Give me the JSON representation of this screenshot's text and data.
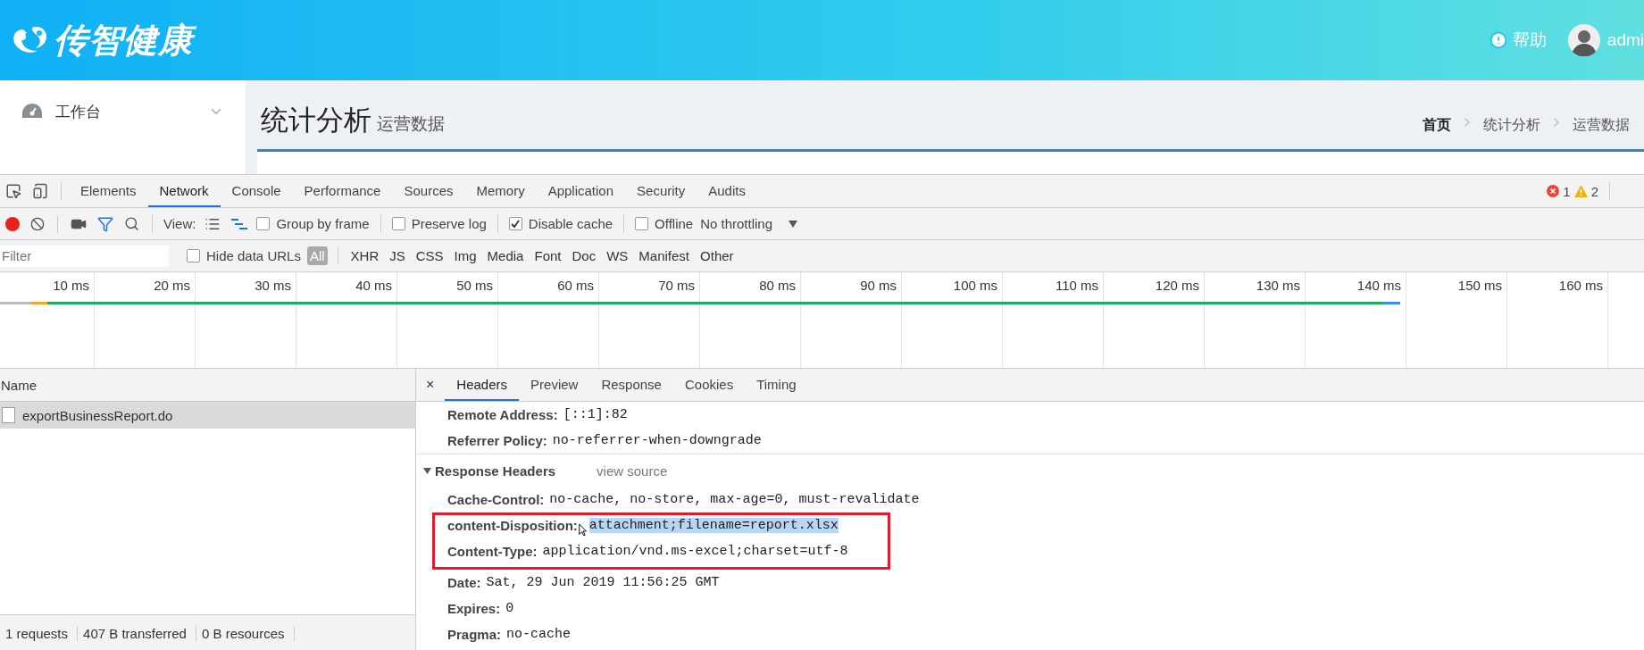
{
  "header": {
    "logo_text": "传智健康",
    "help": "帮助",
    "user": "admi"
  },
  "sidebar": {
    "items": [
      {
        "label": "工作台"
      }
    ]
  },
  "page": {
    "title": "统计分析",
    "subtitle": "运营数据",
    "breadcrumb": [
      "首页",
      "统计分析",
      "运营数据"
    ]
  },
  "devtools": {
    "tabs": [
      {
        "label": "Elements",
        "selected": false
      },
      {
        "label": "Network",
        "selected": true
      },
      {
        "label": "Console",
        "selected": false
      },
      {
        "label": "Performance",
        "selected": false
      },
      {
        "label": "Sources",
        "selected": false
      },
      {
        "label": "Memory",
        "selected": false
      },
      {
        "label": "Application",
        "selected": false
      },
      {
        "label": "Security",
        "selected": false
      },
      {
        "label": "Audits",
        "selected": false
      }
    ],
    "errors": "1",
    "warnings": "2",
    "toolbar": {
      "recording": true,
      "view_label": "View:",
      "options": [
        {
          "label": "Group by frame",
          "checked": false
        },
        {
          "label": "Preserve log",
          "checked": false
        },
        {
          "label": "Disable cache",
          "checked": true
        },
        {
          "label": "Offline",
          "checked": false
        }
      ],
      "throttling": "No throttling"
    },
    "filter": {
      "placeholder": "Filter",
      "hide_data_urls": {
        "label": "Hide data URLs",
        "checked": false
      },
      "types": [
        {
          "label": "All",
          "selected": true
        },
        {
          "label": "XHR",
          "selected": false
        },
        {
          "label": "JS",
          "selected": false
        },
        {
          "label": "CSS",
          "selected": false
        },
        {
          "label": "Img",
          "selected": false
        },
        {
          "label": "Media",
          "selected": false
        },
        {
          "label": "Font",
          "selected": false
        },
        {
          "label": "Doc",
          "selected": false
        },
        {
          "label": "WS",
          "selected": false
        },
        {
          "label": "Manifest",
          "selected": false
        },
        {
          "label": "Other",
          "selected": false
        }
      ]
    },
    "timeline": {
      "ticks": [
        "10 ms",
        "20 ms",
        "30 ms",
        "40 ms",
        "50 ms",
        "60 ms",
        "70 ms",
        "80 ms",
        "90 ms",
        "100 ms",
        "110 ms",
        "120 ms",
        "130 ms",
        "140 ms",
        "150 ms",
        "160 ms"
      ]
    },
    "requests": {
      "column": "Name",
      "rows": [
        {
          "name": "exportBusinessReport.do",
          "selected": true
        }
      ]
    },
    "details": {
      "close": "×",
      "tabs": [
        {
          "label": "Headers",
          "selected": true
        },
        {
          "label": "Preview",
          "selected": false
        },
        {
          "label": "Response",
          "selected": false
        },
        {
          "label": "Cookies",
          "selected": false
        },
        {
          "label": "Timing",
          "selected": false
        }
      ],
      "general": [
        {
          "key": "Remote Address:",
          "value": "[::1]:82"
        },
        {
          "key": "Referrer Policy:",
          "value": "no-referrer-when-downgrade"
        }
      ],
      "response_headers": {
        "title": "Response Headers",
        "expanded": true,
        "view_source": "view source",
        "rows": [
          {
            "key": "Cache-Control:",
            "value": "no-cache, no-store, max-age=0, must-revalidate",
            "annotated": false,
            "value_selected": false
          },
          {
            "key": "content-Disposition:",
            "value": "attachment;filename=report.xlsx",
            "annotated": true,
            "value_selected": true
          },
          {
            "key": "Content-Type:",
            "value": "application/vnd.ms-excel;charset=utf-8",
            "annotated": true,
            "value_selected": false
          },
          {
            "key": "Date:",
            "value": "Sat, 29 Jun 2019 11:56:25 GMT",
            "annotated": false,
            "value_selected": false
          },
          {
            "key": "Expires:",
            "value": "0",
            "annotated": false,
            "value_selected": false
          },
          {
            "key": "Pragma:",
            "value": "no-cache",
            "annotated": false,
            "value_selected": false
          }
        ]
      }
    },
    "status": [
      "1 requests",
      "407 B transferred",
      "0 B resources"
    ]
  }
}
